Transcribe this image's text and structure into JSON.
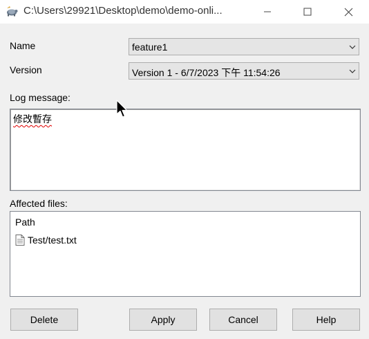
{
  "window": {
    "title": "C:\\Users\\29921\\Desktop\\demo\\demo-onli..."
  },
  "titlebar_buttons": {
    "minimize_icon": "minimize-icon",
    "maximize_icon": "maximize-icon",
    "close_icon": "close-icon"
  },
  "form": {
    "name_label": "Name",
    "name_value": "feature1",
    "version_label": "Version",
    "version_value": "Version 1 - 6/7/2023 下午 11:54:26",
    "log_label": "Log message:",
    "log_value": "修改暫存",
    "affected_label": "Affected files:"
  },
  "files": {
    "header": "Path",
    "items": [
      {
        "path": "Test/test.txt"
      }
    ]
  },
  "buttons": {
    "delete": "Delete",
    "apply": "Apply",
    "cancel": "Cancel",
    "help": "Help"
  },
  "colors": {
    "window_bg": "#f0f0f0",
    "titlebar_bg": "#ffffff",
    "spellcheck_underline": "#e00000"
  }
}
